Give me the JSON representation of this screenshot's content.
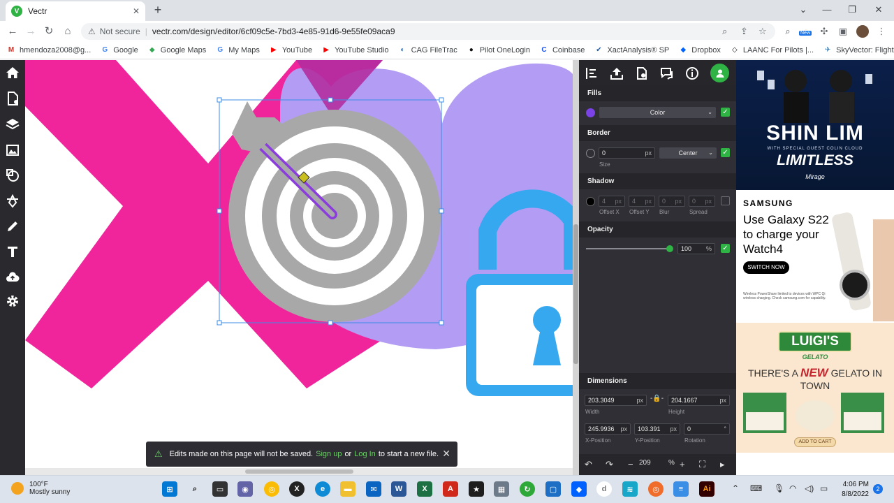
{
  "browser": {
    "tab_title": "Vectr",
    "not_secure": "Not secure",
    "url": "vectr.com/design/editor/6cf09c5e-7bd3-4e85-91d6-9e55fe09aca9",
    "new_badge": "New",
    "bookmarks": [
      {
        "label": "hmendoza2008@g...",
        "icon": "gmail-icon",
        "color": "#d93025",
        "glyph": "M"
      },
      {
        "label": "Google",
        "icon": "google-icon",
        "color": "#4285f4",
        "glyph": "G"
      },
      {
        "label": "Google Maps",
        "icon": "maps-icon",
        "color": "#34a853",
        "glyph": "◆"
      },
      {
        "label": "My Maps",
        "icon": "google-icon",
        "color": "#4285f4",
        "glyph": "G"
      },
      {
        "label": "YouTube",
        "icon": "youtube-icon",
        "color": "#ff0000",
        "glyph": "▶"
      },
      {
        "label": "YouTube Studio",
        "icon": "youtube-icon",
        "color": "#ff0000",
        "glyph": "▶"
      },
      {
        "label": "CAG FileTrac",
        "icon": "filetrac-icon",
        "color": "#1565c0",
        "glyph": "◐"
      },
      {
        "label": "Pilot OneLogin",
        "icon": "onelogin-icon",
        "color": "#111111",
        "glyph": "●"
      },
      {
        "label": "Coinbase",
        "icon": "coinbase-icon",
        "color": "#1652f0",
        "glyph": "C"
      },
      {
        "label": "XactAnalysis® SP",
        "icon": "xact-icon",
        "color": "#1e5aa8",
        "glyph": "✔"
      },
      {
        "label": "Dropbox",
        "icon": "dropbox-icon",
        "color": "#0061ff",
        "glyph": "◆"
      },
      {
        "label": "LAANC For Pilots |...",
        "icon": "laanc-icon",
        "color": "#222222",
        "glyph": "◇"
      },
      {
        "label": "SkyVector: Flight Pl...",
        "icon": "skyvector-icon",
        "color": "#1f6fb2",
        "glyph": "✈"
      }
    ]
  },
  "panel": {
    "fills_title": "Fills",
    "fill_color": "#7b42e8",
    "fill_type": "Color",
    "border_title": "Border",
    "border_size": "0",
    "border_size_label": "Size",
    "border_position": "Center",
    "unit_px": "px",
    "shadow_title": "Shadow",
    "shadow_offset_x": "4",
    "shadow_offset_y": "4",
    "shadow_blur": "0",
    "shadow_spread": "0",
    "shadow_labels": {
      "offset_x": "Offset X",
      "offset_y": "Offset Y",
      "blur": "Blur",
      "spread": "Spread"
    },
    "opacity_title": "Opacity",
    "opacity_value": "100",
    "opacity_unit": "%",
    "opacity_level": 1.0,
    "dimensions_title": "Dimensions",
    "width": "203.3049",
    "height": "204.1667",
    "x_position": "245.9936",
    "y_position": "103.391",
    "rotation": "0",
    "rotation_unit": "°",
    "labels": {
      "width": "Width",
      "height": "Height",
      "x_position": "X-Position",
      "y_position": "Y-Position",
      "rotation": "Rotation"
    },
    "zoom_value": "209",
    "zoom_unit": "%"
  },
  "toast": {
    "before": "Edits made on this page will not be saved.",
    "sign_up": "Sign up",
    "or": "or",
    "log_in": "Log In",
    "after": "to start a new file."
  },
  "ads": {
    "ad1": {
      "headline": "SHIN LIM",
      "guest": "WITH SPECIAL GUEST COLIN CLOUD",
      "show": "LIMITLESS",
      "venue": "Mirage"
    },
    "ad2": {
      "brand": "SAMSUNG",
      "headline": "Use Galaxy S22 to charge your Watch4",
      "cta": "SWITCH NOW",
      "fine_print": "Wireless PowerShare limited to devices with WPC Qi wireless charging. Check samsung.com for capability."
    },
    "ad3": {
      "brand": "LUIGI'S",
      "sub": "GELATO",
      "tag_a": "THERE'S A",
      "tag_new": "NEW",
      "tag_b": "GELATO IN TOWN",
      "cta": "ADD TO CART"
    }
  },
  "taskbar": {
    "temperature": "100°F",
    "weather": "Mostly sunny",
    "time": "4:06 PM",
    "date": "8/8/2022",
    "notifications": "2"
  },
  "colors": {
    "brand_green": "#2fb344",
    "shape_pink": "#f0259b",
    "shape_lavender": "#b39cf3",
    "shape_blue": "#35a8f0",
    "target_gray": "#a8a8a8",
    "arrow_purple": "#8a3cdc"
  }
}
